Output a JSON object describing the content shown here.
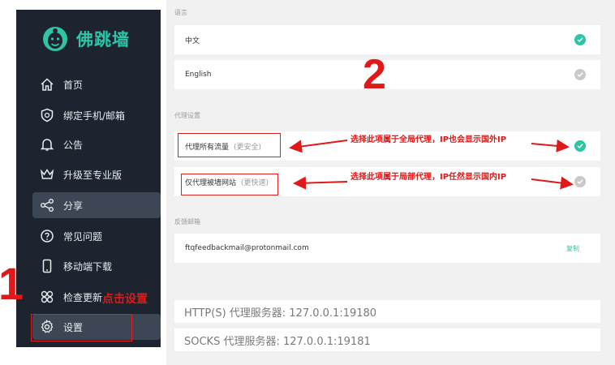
{
  "app": {
    "name": "佛跳墙",
    "logo_icon": "buddha-face-icon",
    "accent_color": "#2ec4a6",
    "sidebar_bg": "#1d2430"
  },
  "sidebar": {
    "items": [
      {
        "label": "首页",
        "icon": "home-icon"
      },
      {
        "label": "绑定手机/邮箱",
        "icon": "shield-icon"
      },
      {
        "label": "公告",
        "icon": "bell-icon"
      },
      {
        "label": "升级至专业版",
        "icon": "crown-icon"
      },
      {
        "label": "分享",
        "icon": "share-icon"
      },
      {
        "label": "常见问题",
        "icon": "question-icon"
      },
      {
        "label": "移动端下载",
        "icon": "phone-icon"
      },
      {
        "label": "检查更新",
        "icon": "flower-icon"
      },
      {
        "label": "设置",
        "icon": "gear-icon"
      }
    ]
  },
  "settings": {
    "language": {
      "label": "语言",
      "options": [
        {
          "label": "中文",
          "selected": true
        },
        {
          "label": "English",
          "selected": false
        }
      ]
    },
    "proxy": {
      "label": "代理设置",
      "options": [
        {
          "label": "代理所有流量",
          "hint": "(更安全)",
          "selected": true
        },
        {
          "label": "仅代理被墙网站",
          "hint": "(更快速)",
          "selected": false
        }
      ]
    },
    "feedback": {
      "label": "反馈邮箱",
      "email": "ftqfeedbackmail@protonmail.com",
      "copy_label": "复制"
    },
    "http_proxy": "HTTP(S) 代理服务器: 127.0.0.1:19180",
    "socks_proxy": "SOCKS 代理服务器: 127.0.0.1:19181"
  },
  "annotations": {
    "step1": "1",
    "step2": "2",
    "click_settings": "点击设置",
    "global_note": "选择此项属于全局代理，IP也会显示国外IP",
    "partial_note": "选择此项属于局部代理，IP任然显示国内IP",
    "color": "#e01818"
  }
}
